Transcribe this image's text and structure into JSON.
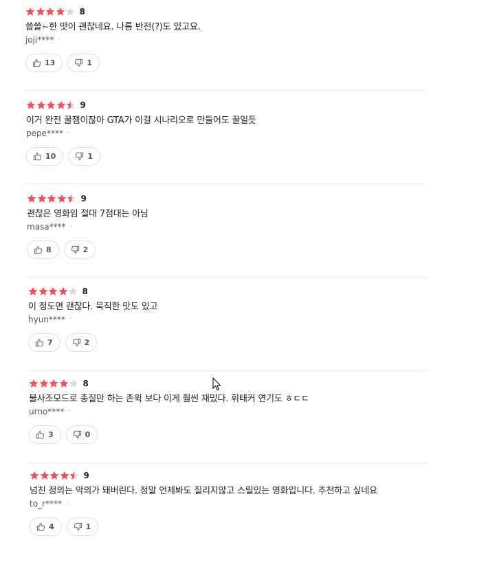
{
  "colors": {
    "star_filled": "#f0505a",
    "star_empty": "#d9d9d9",
    "divider": "#ececec"
  },
  "reviews": [
    {
      "rating": 4,
      "score": "8",
      "text": "씁쓸~한 맛이 괜찮네요. 나름 반전(?)도 있고요.",
      "author": "joji****",
      "dot": "·",
      "likes": "13",
      "dislikes": "1"
    },
    {
      "rating": 4.5,
      "score": "9",
      "text": "이거 완전 꿀잼이잖아 GTA가 이걸 시나리오로 만들어도 꿀일듯",
      "author": "pepe****",
      "dot": "·",
      "likes": "10",
      "dislikes": "1"
    },
    {
      "rating": 4.5,
      "score": "9",
      "text": "괜찮은 영화임 절대 7점대는 아님",
      "author": "masa****",
      "dot": "·",
      "likes": "8",
      "dislikes": "2"
    },
    {
      "rating": 4,
      "score": "8",
      "text": "이 정도면 괜찮다. 묵직한 맛도 있고",
      "author": "hyun****",
      "dot": "·",
      "likes": "7",
      "dislikes": "2"
    },
    {
      "rating": 4,
      "score": "8",
      "text": "불사조모드로 총질만 하는 존윅 보다 이게 훨씬 재밌다. 휘태커 연기도 ㅎㄷㄷ",
      "author": "urno****",
      "dot": "·",
      "likes": "3",
      "dislikes": "0"
    },
    {
      "rating": 4.5,
      "score": "9",
      "text": "넘친 정의는 악의가 돼버린다. 정말 언제봐도 질리지않고 스릴있는 영화입니다. 추천하고 싶네요",
      "author": "to_r****",
      "dot": "·",
      "likes": "4",
      "dislikes": "1"
    }
  ]
}
